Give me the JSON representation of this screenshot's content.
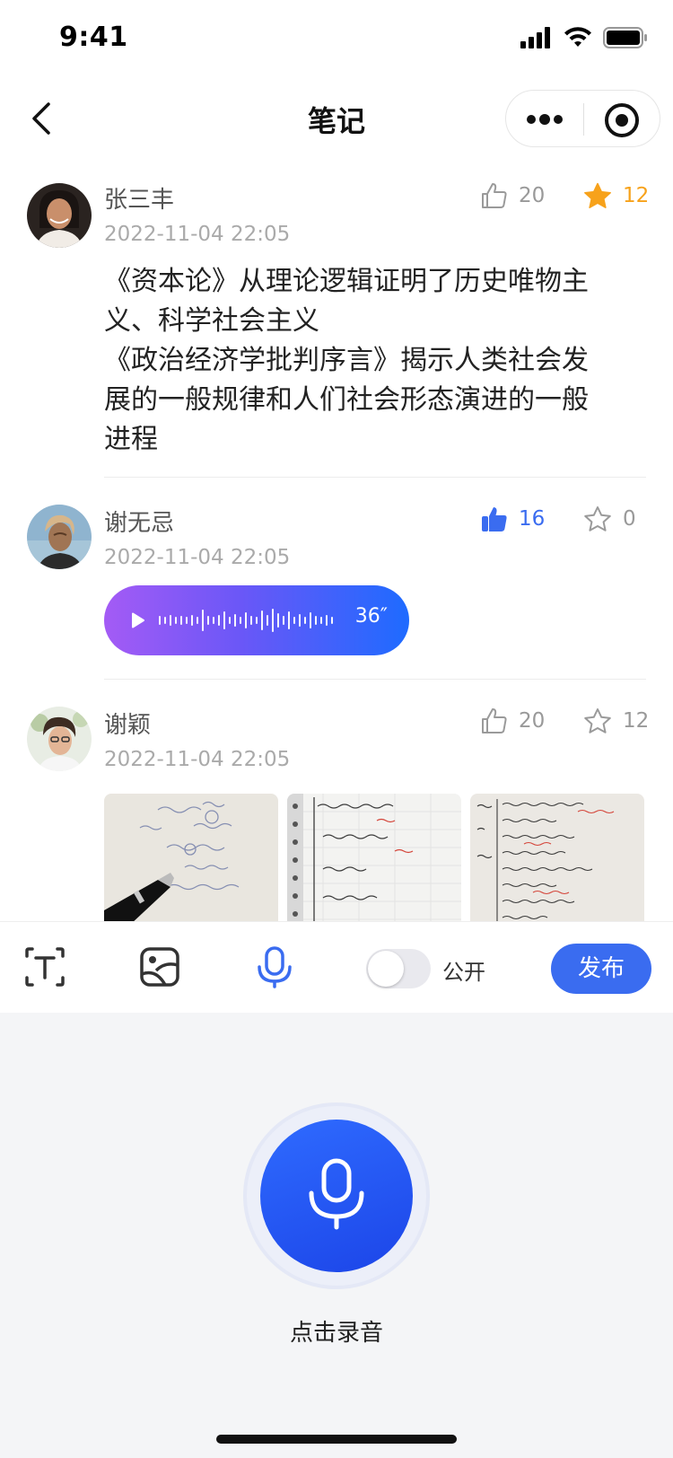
{
  "status_bar": {
    "time": "9:41"
  },
  "nav": {
    "title": "笔记"
  },
  "posts": [
    {
      "author": "张三丰",
      "time": "2022-11-04 22:05",
      "likes": "20",
      "favorites": "12",
      "text_lines": [
        "《资本论》从理论逻辑证明了历史唯物主",
        "义、科学社会主义",
        "《政治经济学批判序言》揭示人类社会发",
        "展的一般规律和人们社会形态演进的一般",
        "进程"
      ]
    },
    {
      "author": "谢无忌",
      "time": "2022-11-04 22:05",
      "likes": "16",
      "favorites": "0",
      "voice_duration": "36″"
    },
    {
      "author": "谢颖",
      "time": "2022-11-04 22:05",
      "likes": "20",
      "favorites": "12"
    }
  ],
  "toolbar": {
    "public_label": "公开",
    "publish_label": "发布"
  },
  "recorder": {
    "label": "点击录音"
  },
  "colors": {
    "accent": "#3a6cf0",
    "star": "#f7a21b",
    "like_active": "#3a6cf0"
  }
}
